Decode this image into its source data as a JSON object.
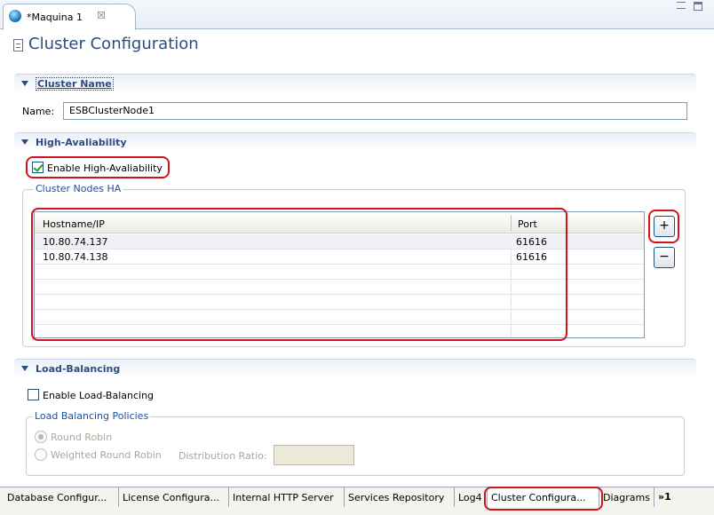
{
  "editor_tab": {
    "title": "*Maquina 1",
    "close_glyph": "☒"
  },
  "form": {
    "title": "Cluster Configuration",
    "icon": "document-icon"
  },
  "cluster_name": {
    "section_label": "Cluster Name",
    "name_label": "Name:",
    "name_value": "ESBClusterNode1"
  },
  "high_availability": {
    "section_label": "High-Avaliability",
    "enable_label": "Enable High-Avaliability",
    "enabled": true,
    "group_title": "Cluster Nodes HA",
    "table": {
      "headers": [
        "Hostname/IP",
        "Port"
      ],
      "rows": [
        {
          "host": "10.80.74.137",
          "port": "61616"
        },
        {
          "host": "10.80.74.138",
          "port": "61616"
        }
      ]
    },
    "add_label": "+",
    "remove_label": "−"
  },
  "load_balancing": {
    "section_label": "Load-Balancing",
    "enable_label": "Enable Load-Balancing",
    "enabled": false,
    "group_title": "Load Balancing Policies",
    "policy_round_robin": "Round Robin",
    "policy_weighted": "Weighted Round Robin",
    "selected_policy": "Round Robin",
    "ratio_label": "Distribution Ratio:",
    "ratio_value": ""
  },
  "page_tabs": {
    "database": "Database Configur...",
    "license": "License Configura...",
    "http": "Internal HTTP Server",
    "repository": "Services Repository",
    "log": "Log4",
    "cluster": "Cluster Configura...",
    "diagrams": "Diagrams",
    "more": "»1",
    "active": "Cluster Configura..."
  },
  "colors": {
    "highlight": "#d0151b",
    "section_title": "#2d4d82",
    "group_title": "#1f4f99"
  }
}
